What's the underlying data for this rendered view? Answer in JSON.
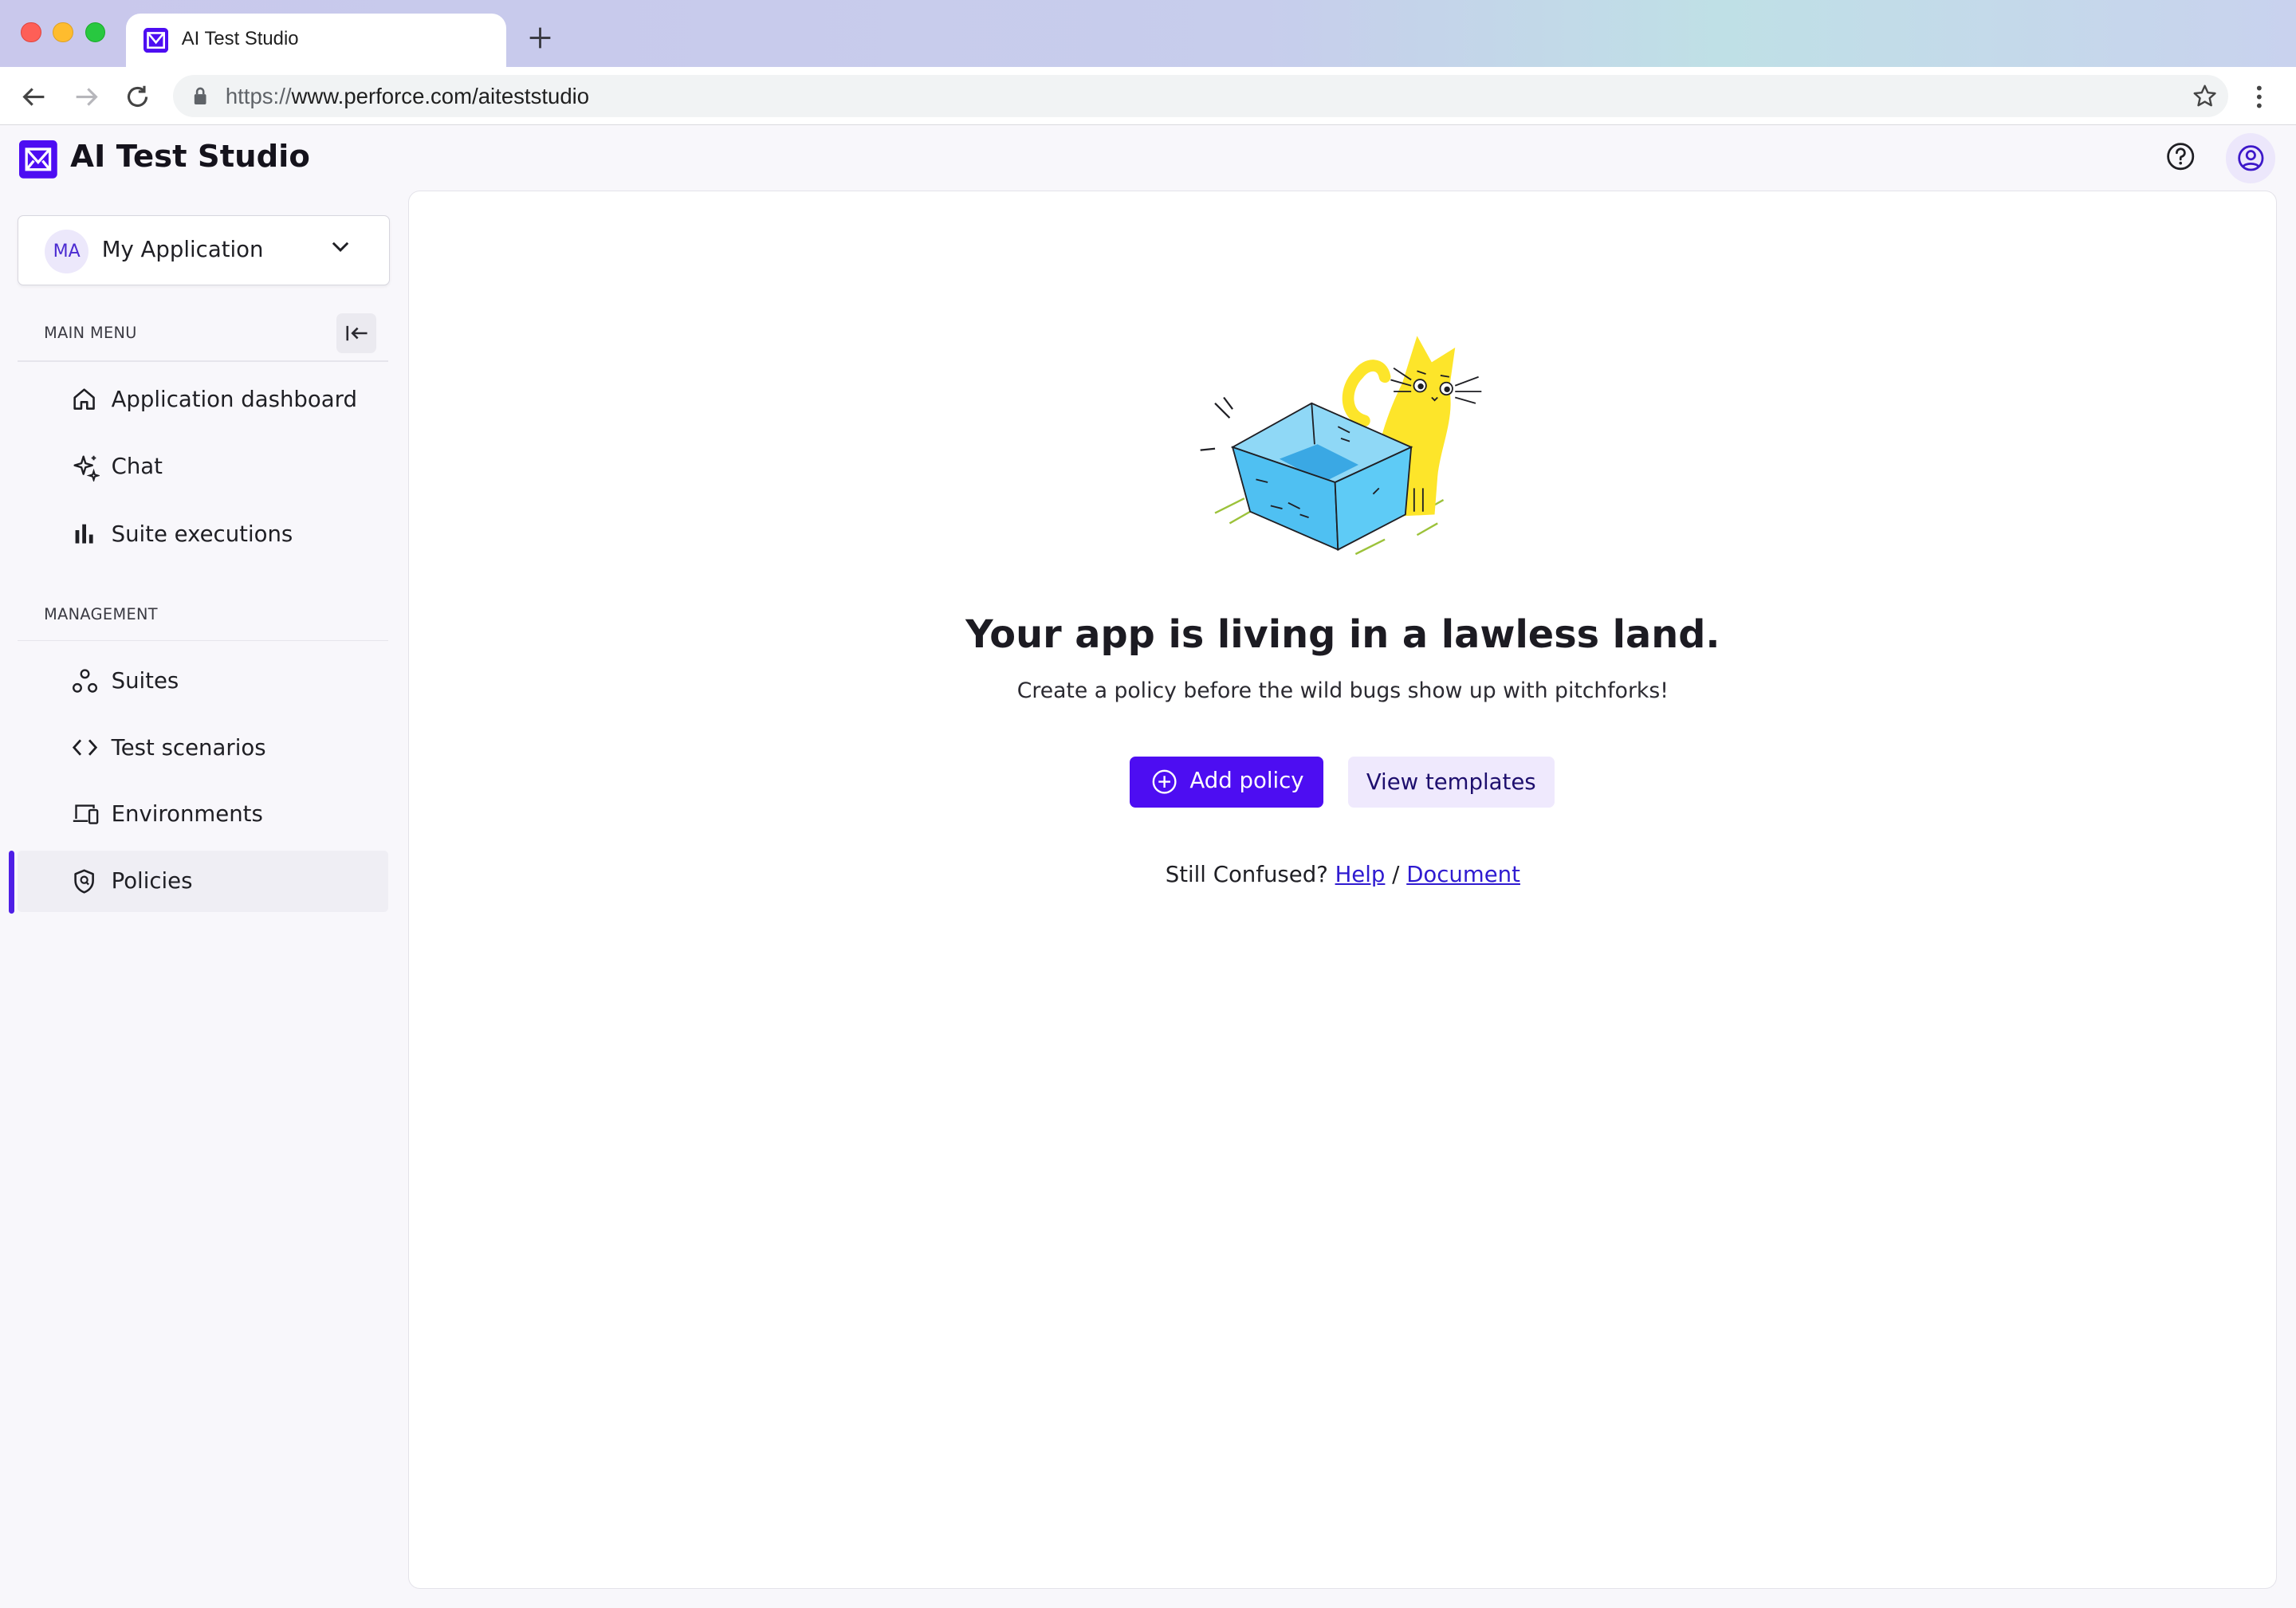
{
  "browser": {
    "tab_title": "AI Test Studio",
    "url_scheme": "https://",
    "url_rest": "www.perforce.com/aiteststudio"
  },
  "header": {
    "app_title": "AI Test Studio"
  },
  "sidebar": {
    "app_select": {
      "badge": "MA",
      "name": "My Application"
    },
    "sections": [
      {
        "label": "MAIN MENU",
        "items": [
          {
            "label": "Application dashboard",
            "icon": "home-icon"
          },
          {
            "label": "Chat",
            "icon": "sparkle-icon"
          },
          {
            "label": "Suite executions",
            "icon": "bar-chart-icon"
          }
        ]
      },
      {
        "label": "MANAGEMENT",
        "items": [
          {
            "label": "Suites",
            "icon": "nodes-icon"
          },
          {
            "label": "Test scenarios",
            "icon": "code-icon"
          },
          {
            "label": "Environments",
            "icon": "devices-icon"
          },
          {
            "label": "Policies",
            "icon": "shield-icon",
            "active": true
          }
        ]
      }
    ]
  },
  "main": {
    "empty_state": {
      "title": "Your app is living in a lawless land.",
      "subtitle": "Create a policy before the wild bugs show up with pitchforks!",
      "primary_button": "Add policy",
      "secondary_button": "View templates",
      "help_prefix": "Still Confused?",
      "help_link": "Help",
      "separator": "/",
      "doc_link": "Document"
    }
  },
  "colors": {
    "primary": "#4d0df2",
    "secondary_bg": "#efe9fd",
    "active_indicator": "#4f1fe6",
    "link": "#2f1bd0"
  }
}
